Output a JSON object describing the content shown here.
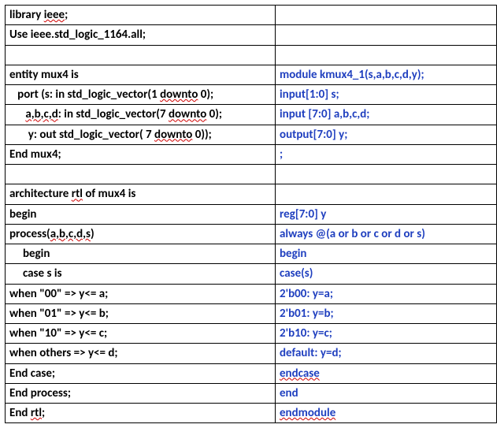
{
  "rows": [
    {
      "left_plain": "library ",
      "left_err": "ieee",
      "left_tail": ";",
      "right": ""
    },
    {
      "left_plain": "Use ieee.std_logic_1164.all;",
      "right": ""
    },
    {
      "left_plain": " ",
      "right": " "
    },
    {
      "left_plain": "entity mux4 is",
      "right": "module kmux4_1(s,a,b,c,d,y);"
    },
    {
      "left_plain": "   port (s: in std_logic_vector(1 ",
      "left_err": "downto",
      "left_tail": " 0);",
      "right": "input[1:0] s;"
    },
    {
      "left_plain": "      ",
      "left_err": "a,b,c,d",
      "left_mid": ": in std_logic_vector(7 ",
      "left_err2": "downto",
      "left_tail": " 0);",
      "right": "input [7:0] a,b,c,d;"
    },
    {
      "left_plain": "       y: out std_logic_vector( 7 ",
      "left_err": "downto",
      "left_tail": " 0));",
      "right": "output[7:0] y;"
    },
    {
      "left_plain": "End mux4;",
      "right": ";"
    },
    {
      "left_plain": " ",
      "right": " "
    },
    {
      "left_plain": "architecture ",
      "left_err": "rtl",
      "left_tail": " of mux4 is",
      "right": ""
    },
    {
      "left_plain": "begin",
      "right": "reg[7:0] y"
    },
    {
      "left_plain": "process(",
      "left_err": "a,b,c,d,s",
      "left_tail": ")",
      "right": "always @(a or b or c or d or s)"
    },
    {
      "left_plain": "     begin",
      "right": "begin"
    },
    {
      "left_plain": "     case s is",
      "right": "case(s)"
    },
    {
      "left_plain": "when \"00\" => y<= a;",
      "right": "2'b00: y=a;"
    },
    {
      "left_plain": "when \"01\" => y<= b;",
      "right": "2'b01: y=b;"
    },
    {
      "left_plain": "when \"10\" => y<= c;",
      "right": "2'b10: y=c;"
    },
    {
      "left_plain": "when others => y<= d;",
      "right": "default: y=d;"
    },
    {
      "left_plain": "End case;",
      "right_err": "endcase"
    },
    {
      "left_plain": "End process;",
      "right": "end"
    },
    {
      "left_plain": "End ",
      "left_err": "rtl",
      "left_tail": ";",
      "right_err": "endmodule"
    }
  ]
}
